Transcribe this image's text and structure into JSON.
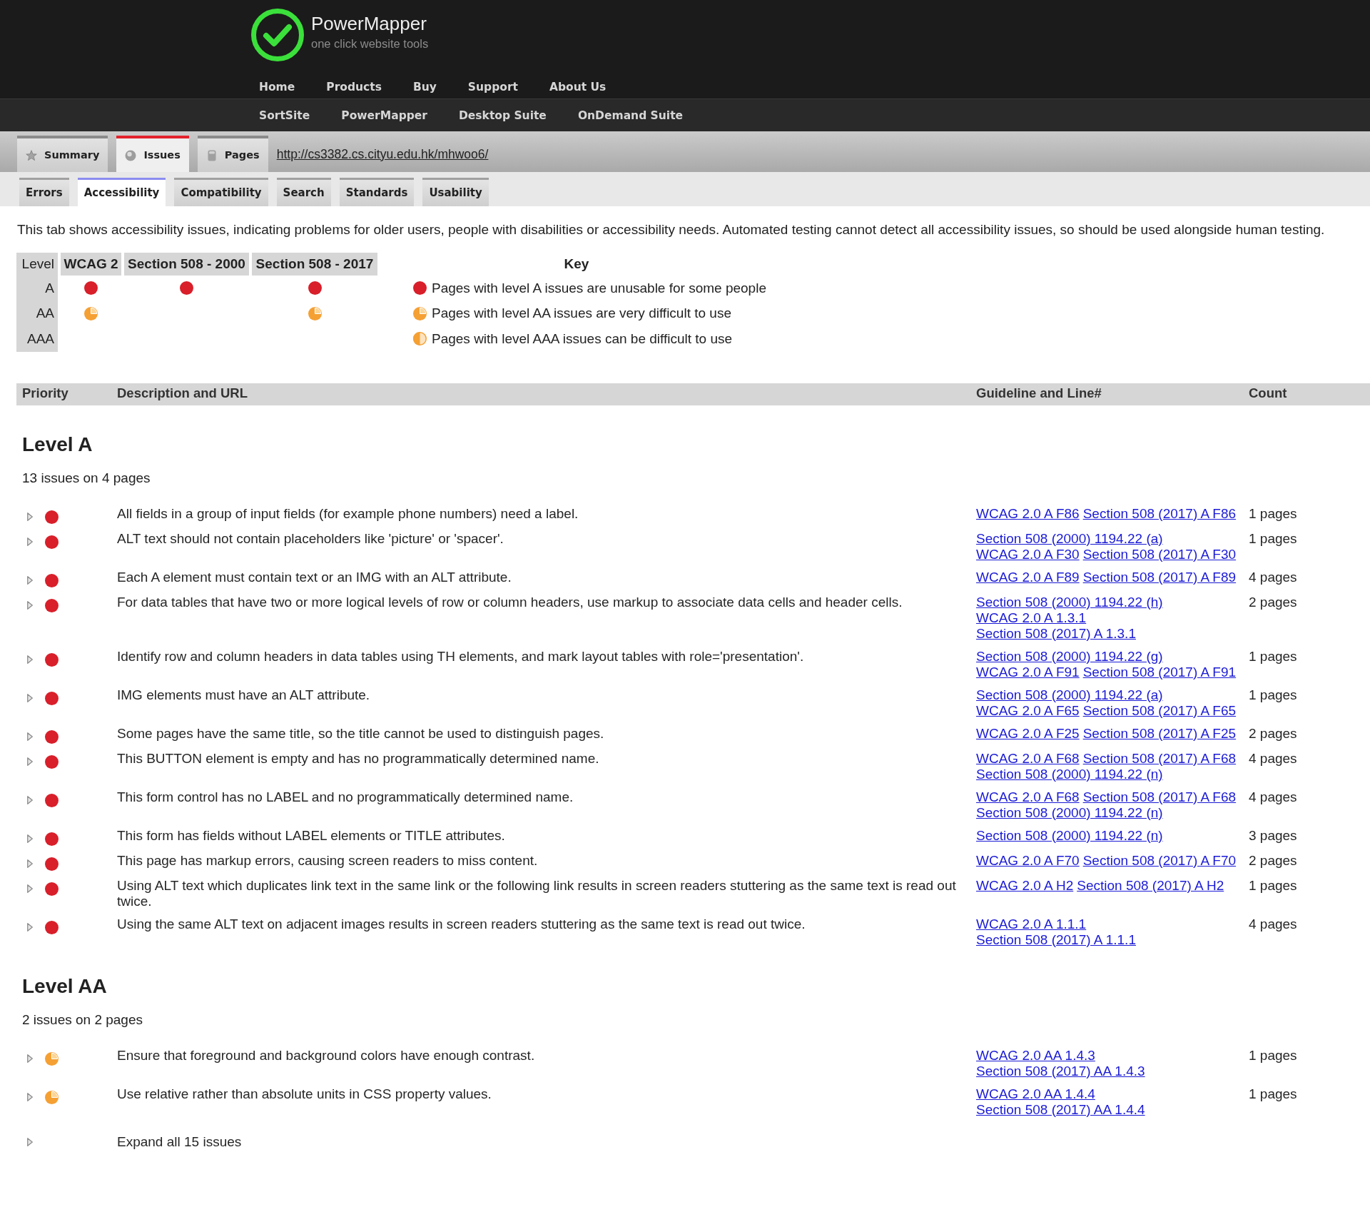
{
  "header": {
    "title": "PowerMapper",
    "tagline": "one click website tools"
  },
  "primary_nav": [
    "Home",
    "Products",
    "Buy",
    "Support",
    "About Us"
  ],
  "secondary_nav": [
    "SortSite",
    "PowerMapper",
    "Desktop Suite",
    "OnDemand Suite"
  ],
  "report_tabs": [
    {
      "label": "Summary",
      "selected": false
    },
    {
      "label": "Issues",
      "selected": true
    },
    {
      "label": "Pages",
      "selected": false
    }
  ],
  "site_url": "http://cs3382.cs.cityu.edu.hk/mhwoo6/",
  "category_tabs": [
    {
      "label": "Errors",
      "selected": false
    },
    {
      "label": "Accessibility",
      "selected": true
    },
    {
      "label": "Compatibility",
      "selected": false
    },
    {
      "label": "Search",
      "selected": false
    },
    {
      "label": "Standards",
      "selected": false
    },
    {
      "label": "Usability",
      "selected": false
    }
  ],
  "intro": "This tab shows accessibility issues, indicating problems for older users, people with disabilities or accessibility needs. Automated testing cannot detect all accessibility issues, so should be used alongside human testing.",
  "level_table": {
    "columns": [
      "Level",
      "WCAG 2",
      "Section 508 - 2000",
      "Section 508 - 2017"
    ],
    "rows": [
      {
        "label": "A",
        "marks": [
          true,
          true,
          true
        ]
      },
      {
        "label": "AA",
        "marks": [
          true,
          false,
          true
        ]
      },
      {
        "label": "AAA",
        "marks": [
          false,
          false,
          false
        ]
      }
    ]
  },
  "key": {
    "title": "Key",
    "items": [
      {
        "kind": "A",
        "text": "Pages with level A issues are unusable for some people"
      },
      {
        "kind": "AA",
        "text": "Pages with level AA issues are very difficult to use"
      },
      {
        "kind": "AAA",
        "text": "Pages with level AAA issues can be difficult to use"
      }
    ]
  },
  "issues": {
    "columns": [
      "Priority",
      "Description and URL",
      "Guideline and Line#",
      "Count"
    ],
    "sections": [
      {
        "title": "Level A",
        "summary": "13 issues on 4 pages",
        "kind": "A",
        "rows": [
          {
            "expanded": false,
            "description": "All fields in a group of input fields (for example phone numbers) need a label.",
            "guidelines": [
              [
                "WCAG 2.0 A F86",
                "Section 508 (2017) A F86"
              ]
            ],
            "count": "1 pages"
          },
          {
            "expanded": false,
            "description": "ALT text should not contain placeholders like 'picture' or 'spacer'.",
            "guidelines": [
              [
                "Section 508 (2000) 1194.22 (a)"
              ],
              [
                "WCAG 2.0 A F30",
                "Section 508 (2017) A F30"
              ]
            ],
            "count": "1 pages"
          },
          {
            "expanded": false,
            "description": "Each A element must contain text or an IMG with an ALT attribute.",
            "guidelines": [
              [
                "WCAG 2.0 A F89",
                "Section 508 (2017) A F89"
              ]
            ],
            "count": "4 pages"
          },
          {
            "expanded": false,
            "description": "For data tables that have two or more logical levels of row or column headers, use markup to associate data cells and header cells.",
            "guidelines": [
              [
                "Section 508 (2000) 1194.22 (h)"
              ],
              [
                "WCAG 2.0 A 1.3.1"
              ],
              [
                "Section 508 (2017) A 1.3.1"
              ]
            ],
            "count": "2 pages"
          },
          {
            "expanded": false,
            "description": "Identify row and column headers in data tables using TH elements, and mark layout tables with role='presentation'.",
            "guidelines": [
              [
                "Section 508 (2000) 1194.22 (g)"
              ],
              [
                "WCAG 2.0 A F91",
                "Section 508 (2017) A F91"
              ]
            ],
            "count": "1 pages"
          },
          {
            "expanded": false,
            "description": "IMG elements must have an ALT attribute.",
            "guidelines": [
              [
                "Section 508 (2000) 1194.22 (a)"
              ],
              [
                "WCAG 2.0 A F65",
                "Section 508 (2017) A F65"
              ]
            ],
            "count": "1 pages"
          },
          {
            "expanded": false,
            "description": "Some pages have the same title, so the title cannot be used to distinguish pages.",
            "guidelines": [
              [
                "WCAG 2.0 A F25",
                "Section 508 (2017) A F25"
              ]
            ],
            "count": "2 pages"
          },
          {
            "expanded": false,
            "description": "This BUTTON element is empty and has no programmatically determined name.",
            "guidelines": [
              [
                "WCAG 2.0 A F68",
                "Section 508 (2017) A F68"
              ],
              [
                "Section 508 (2000) 1194.22 (n)"
              ]
            ],
            "count": "4 pages"
          },
          {
            "expanded": false,
            "description": "This form control has no LABEL and no programmatically determined name.",
            "guidelines": [
              [
                "WCAG 2.0 A F68",
                "Section 508 (2017) A F68"
              ],
              [
                "Section 508 (2000) 1194.22 (n)"
              ]
            ],
            "count": "4 pages"
          },
          {
            "expanded": false,
            "description": "This form has fields without LABEL elements or TITLE attributes.",
            "guidelines": [
              [
                "Section 508 (2000) 1194.22 (n)"
              ]
            ],
            "count": "3 pages"
          },
          {
            "expanded": false,
            "description": "This page has markup errors, causing screen readers to miss content.",
            "guidelines": [
              [
                "WCAG 2.0 A F70",
                "Section 508 (2017) A F70"
              ]
            ],
            "count": "2 pages"
          },
          {
            "expanded": false,
            "description": "Using ALT text which duplicates link text in the same link or the following link results in screen readers stuttering as the same text is read out twice.",
            "guidelines": [
              [
                "WCAG 2.0 A H2",
                "Section 508 (2017) A H2"
              ]
            ],
            "count": "1 pages"
          },
          {
            "expanded": false,
            "description": "Using the same ALT text on adjacent images results in screen readers stuttering as the same text is read out twice.",
            "guidelines": [
              [
                "WCAG 2.0 A 1.1.1"
              ],
              [
                "Section 508 (2017) A 1.1.1"
              ]
            ],
            "count": "4 pages"
          }
        ]
      },
      {
        "title": "Level AA",
        "summary": "2 issues on 2 pages",
        "kind": "AA",
        "rows": [
          {
            "expanded": false,
            "description": "Ensure that foreground and background colors have enough contrast.",
            "guidelines": [
              [
                "WCAG 2.0 AA 1.4.3"
              ],
              [
                "Section 508 (2017) AA 1.4.3"
              ]
            ],
            "count": "1 pages"
          },
          {
            "expanded": false,
            "description": "Use relative rather than absolute units in CSS property values.",
            "guidelines": [
              [
                "WCAG 2.0 AA 1.4.4"
              ],
              [
                "Section 508 (2017) AA 1.4.4"
              ]
            ],
            "count": "1 pages"
          }
        ]
      }
    ],
    "expand_all": "Expand all 15 issues"
  }
}
